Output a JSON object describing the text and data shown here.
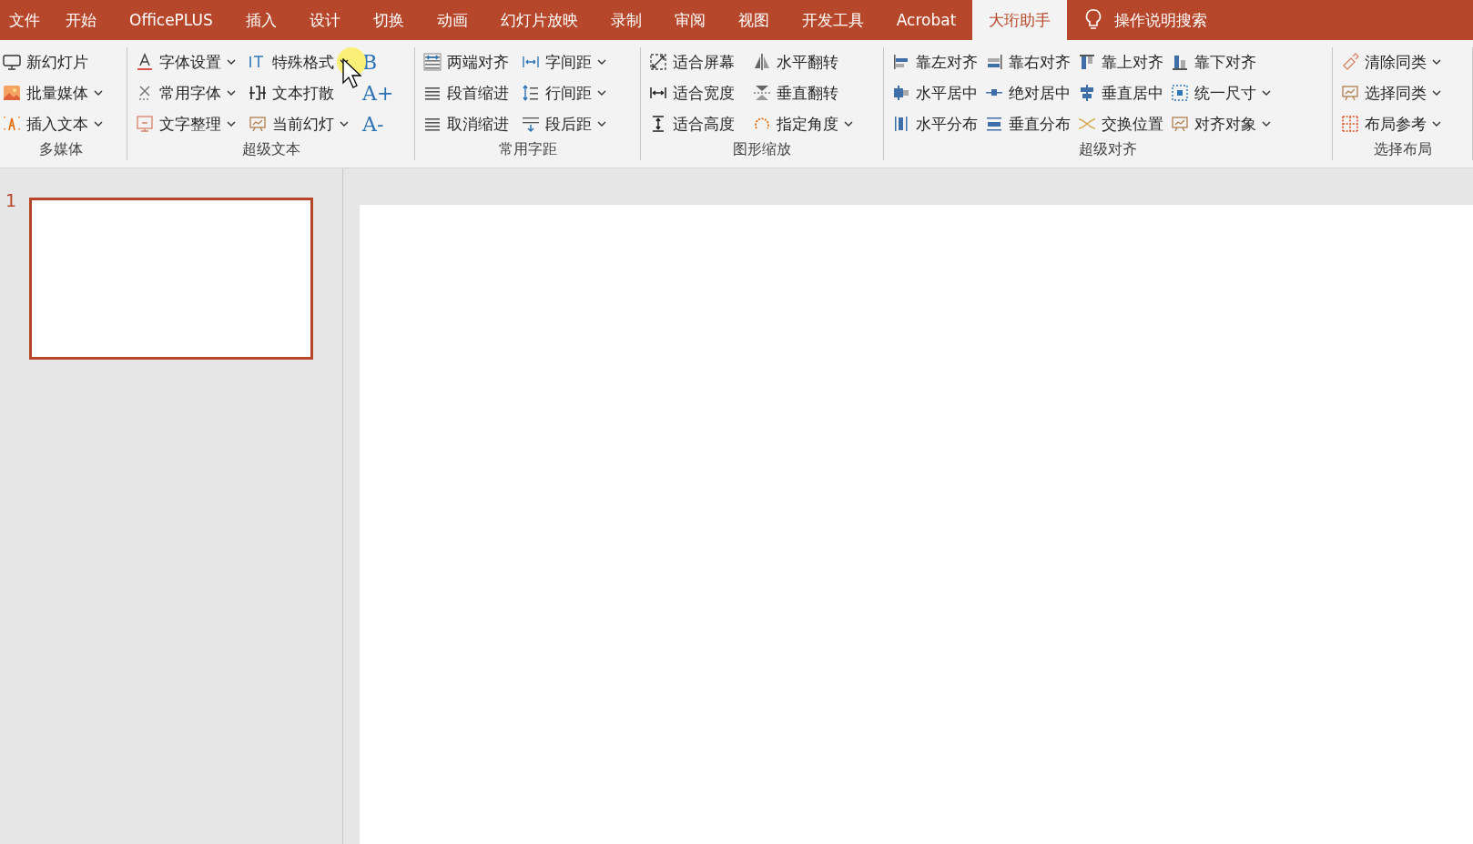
{
  "menu_tabs": [
    {
      "label": "文件",
      "selected": false
    },
    {
      "label": "开始",
      "selected": false
    },
    {
      "label": "OfficePLUS",
      "selected": false
    },
    {
      "label": "插入",
      "selected": false
    },
    {
      "label": "设计",
      "selected": false
    },
    {
      "label": "切换",
      "selected": false
    },
    {
      "label": "动画",
      "selected": false
    },
    {
      "label": "幻灯片放映",
      "selected": false
    },
    {
      "label": "录制",
      "selected": false
    },
    {
      "label": "审阅",
      "selected": false
    },
    {
      "label": "视图",
      "selected": false
    },
    {
      "label": "开发工具",
      "selected": false
    },
    {
      "label": "Acrobat",
      "selected": false
    },
    {
      "label": "大珩助手",
      "selected": true
    }
  ],
  "search": {
    "placeholder": "操作说明搜索"
  },
  "ribbon": {
    "groups": [
      {
        "label": "多媒体",
        "columns": [
          [
            {
              "label": "新幻灯片",
              "dropdown": false
            },
            {
              "label": "批量媒体",
              "dropdown": true
            },
            {
              "label": "插入文本",
              "dropdown": true
            }
          ]
        ]
      },
      {
        "label": "超级文本",
        "columns": [
          [
            {
              "label": "字体设置",
              "dropdown": true
            },
            {
              "label": "常用字体",
              "dropdown": true
            },
            {
              "label": "文字整理",
              "dropdown": true
            }
          ],
          [
            {
              "label": "特殊格式",
              "dropdown": true
            },
            {
              "label": "文本打散",
              "dropdown": false
            },
            {
              "label": "当前幻灯",
              "dropdown": true
            }
          ],
          [
            {
              "label": "B",
              "kind": "glyph"
            },
            {
              "label": "A+",
              "kind": "glyph"
            },
            {
              "label": "A-",
              "kind": "glyph"
            }
          ]
        ]
      },
      {
        "label": "常用字距",
        "columns": [
          [
            {
              "label": "两端对齐",
              "dropdown": false
            },
            {
              "label": "段首缩进",
              "dropdown": false
            },
            {
              "label": "取消缩进",
              "dropdown": false
            }
          ],
          [
            {
              "label": "字间距",
              "dropdown": true
            },
            {
              "label": "行间距",
              "dropdown": true
            },
            {
              "label": "段后距",
              "dropdown": true
            }
          ]
        ]
      },
      {
        "label": "图形缩放",
        "columns": [
          [
            {
              "label": "适合屏幕",
              "dropdown": false
            },
            {
              "label": "适合宽度",
              "dropdown": false
            },
            {
              "label": "适合高度",
              "dropdown": false
            }
          ],
          [
            {
              "label": "水平翻转",
              "dropdown": false
            },
            {
              "label": "垂直翻转",
              "dropdown": false
            },
            {
              "label": "指定角度",
              "dropdown": true
            }
          ]
        ]
      },
      {
        "label": "超级对齐",
        "columns": [
          [
            {
              "label": "靠左对齐",
              "dropdown": false
            },
            {
              "label": "水平居中",
              "dropdown": false
            },
            {
              "label": "水平分布",
              "dropdown": false
            }
          ],
          [
            {
              "label": "靠右对齐",
              "dropdown": false
            },
            {
              "label": "绝对居中",
              "dropdown": false
            },
            {
              "label": "垂直分布",
              "dropdown": false
            }
          ],
          [
            {
              "label": "靠上对齐",
              "dropdown": false
            },
            {
              "label": "垂直居中",
              "dropdown": false
            },
            {
              "label": "交换位置",
              "dropdown": false
            }
          ],
          [
            {
              "label": "靠下对齐",
              "dropdown": false
            },
            {
              "label": "统一尺寸",
              "dropdown": true
            },
            {
              "label": "对齐对象",
              "dropdown": true
            }
          ]
        ]
      },
      {
        "label": "选择布局",
        "columns": [
          [
            {
              "label": "清除同类",
              "dropdown": true
            },
            {
              "label": "选择同类",
              "dropdown": true
            },
            {
              "label": "布局参考",
              "dropdown": true
            }
          ]
        ]
      }
    ]
  },
  "slides": [
    {
      "number": "1",
      "selected": true
    }
  ]
}
